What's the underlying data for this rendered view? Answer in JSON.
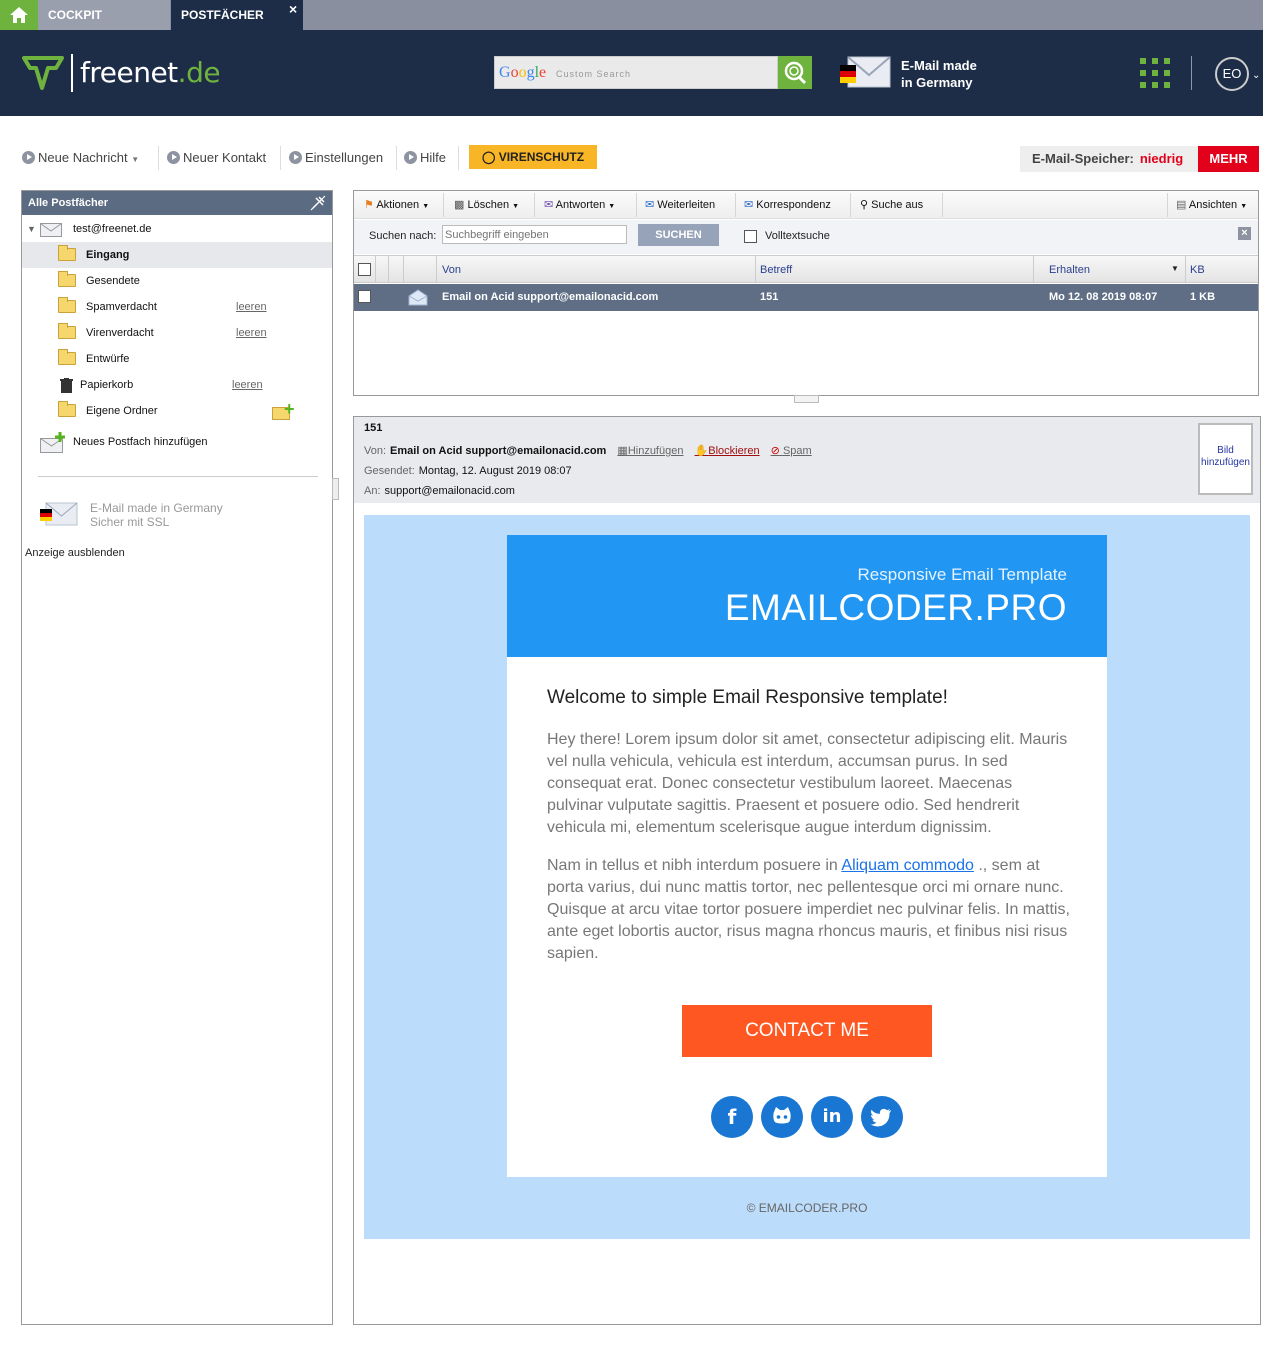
{
  "tabs": [
    {
      "label": "COCKPIT"
    },
    {
      "label": "POSTFÄCHER",
      "close": "×"
    }
  ],
  "header": {
    "brand_a": "freenet",
    "brand_b": ".de",
    "search_google": "Google",
    "search_placeholder": "Custom Search",
    "made_in_line1": "E-Mail made",
    "made_in_line2": "in Germany",
    "user_initials": "EO",
    "brand_color": "#6fb33f"
  },
  "toolbar": {
    "new_message": "Neue Nachricht",
    "new_contact": "Neuer Kontakt",
    "settings": "Einstellungen",
    "help": "Hilfe",
    "antivirus": "VIRENSCHUTZ",
    "storage_label": "E-Mail-Speicher:",
    "storage_level": "niedrig",
    "more": "MEHR"
  },
  "sidebar": {
    "title": "Alle Postfächer",
    "account": "test@freenet.de",
    "folders": [
      {
        "label": "Eingang",
        "selected": true
      },
      {
        "label": "Gesendete"
      },
      {
        "label": "Spamverdacht",
        "action": "leeren"
      },
      {
        "label": "Virenverdacht",
        "action": "leeren"
      },
      {
        "label": "Entwürfe"
      },
      {
        "label": "Papierkorb",
        "action": "leeren"
      },
      {
        "label": "Eigene Ordner"
      }
    ],
    "add_mailbox": "Neues Postfach hinzufügen",
    "ad_line1": "E-Mail made in Germany",
    "ad_line2": "Sicher mit SSL",
    "hide_ad": "Anzeige ausblenden"
  },
  "list_toolbar": {
    "actions": "Aktionen",
    "delete": "Löschen",
    "reply": "Antworten",
    "forward": "Weiterleiten",
    "correspondence": "Korrespondenz",
    "search_off": "Suche aus",
    "views": "Ansichten",
    "search_label": "Suchen nach:",
    "search_placeholder": "Suchbegriff eingeben",
    "search_button": "SUCHEN",
    "fulltext": "Volltextsuche"
  },
  "list": {
    "columns": {
      "from": "Von",
      "subject": "Betreff",
      "received": "Erhalten",
      "size": "KB"
    },
    "rows": [
      {
        "from": "Email on Acid support@emailonacid.com",
        "subject": "151",
        "received": "Mo 12. 08 2019 08:07",
        "size": "1 KB"
      }
    ]
  },
  "preview": {
    "subject": "151",
    "from_label": "Von:",
    "from_value": "Email on Acid support@emailonacid.com",
    "add_contact": "Hinzufügen",
    "block": "Blockieren",
    "spam": "Spam",
    "sent_label": "Gesendet:",
    "sent_value": "Montag, 12. August 2019 08:07",
    "to_label": "An:",
    "to_value": "support@emailonacid.com",
    "photo_line1": "Bild",
    "photo_line2": "hinzufügen"
  },
  "email": {
    "banner_sub": "Responsive Email Template",
    "banner_brand": "EMAILCODER.PRO",
    "heading": "Welcome to simple Email Responsive template!",
    "para1": "Hey there! Lorem ipsum dolor sit amet, consectetur adipiscing elit. Mauris vel nulla vehicula, vehicula est interdum, accumsan purus. In sed consequat erat. Donec consectetur vestibulum laoreet. Maecenas pulvinar vulputate sagittis. Praesent et posuere odio. Sed hendrerit vehicula mi, elementum scelerisque augue interdum dignissim.",
    "para2_before": "Nam in tellus et nibh interdum posuere in ",
    "para2_link": "Aliquam commodo",
    "para2_after": " ., sem at porta varius, dui nunc mattis tortor, nec pellentesque orci mi ornare nunc. Quisque at arcu vitae tortor posuere imperdiet nec pulvinar felis. In mattis, ante eget lobortis auctor, risus magna rhoncus mauris, et finibus nisi risus sapien.",
    "cta": "CONTACT ME",
    "footer": "© EMAILCODER.PRO",
    "accent": "#2196f3",
    "cta_color": "#ff5722"
  }
}
